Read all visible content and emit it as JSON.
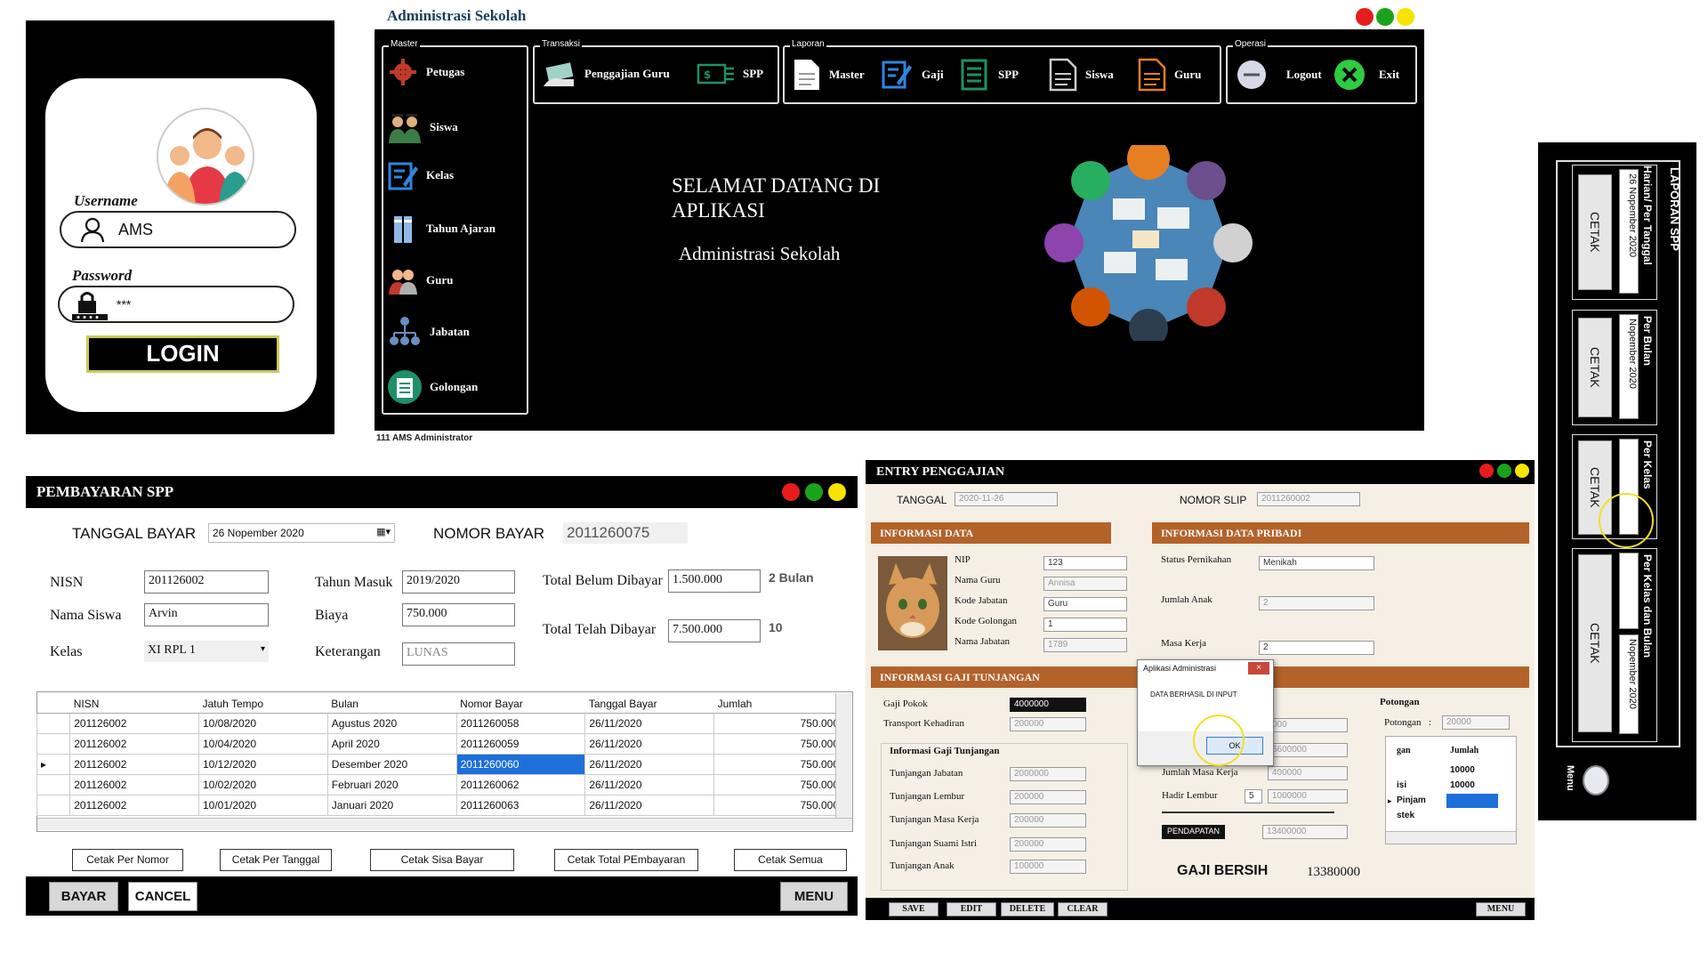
{
  "colors": {
    "dot_red": "#e81c1c",
    "dot_green": "#1aa31a",
    "dot_yellow": "#f5e300",
    "section_brown": "#b3622a",
    "selection_blue": "#1e6fd9",
    "title_navy": "#1a3d5c"
  },
  "login": {
    "username_label": "Username",
    "username_value": "AMS",
    "password_label": "Password",
    "password_value": "***",
    "login_button": "LOGIN",
    "icons": [
      "user-avatar-group-icon",
      "user-icon",
      "lock-icon"
    ]
  },
  "main": {
    "title": "Administrasi Sekolah",
    "groups": {
      "master": "Master",
      "transaksi": "Transaksi",
      "laporan": "Laporan",
      "operasi": "Operasi"
    },
    "master_items": [
      "Petugas",
      "Siswa",
      "Kelas",
      "Tahun Ajaran",
      "Guru",
      "Jabatan",
      "Golongan"
    ],
    "transaksi_items": [
      "Penggajian Guru",
      "SPP"
    ],
    "laporan_items": [
      "Master",
      "Gaji",
      "SPP",
      "Siswa",
      "Guru"
    ],
    "operasi_items": [
      "Logout",
      "Exit"
    ],
    "welcome_line1": "SELAMAT DATANG DI",
    "welcome_line2": "APLIKASI",
    "welcome_sub": "Administrasi Sekolah",
    "status_bar": "111  AMS  Administrator"
  },
  "laporan_spp": {
    "title": "LAPORAN SPP",
    "sections": [
      {
        "label": "Harian/ Per Tanggal",
        "date": "26 Nopember 2020",
        "button": "CETAK"
      },
      {
        "label": "Per Bulan",
        "date": "Nopember 2020",
        "button": "CETAK"
      },
      {
        "label": "Per Kelas",
        "date": "",
        "button": "CETAK"
      },
      {
        "label": "Per Kelas dan Bulan",
        "date": "Nopember 2020",
        "button": "CETAK"
      }
    ],
    "menu_label": "Menu"
  },
  "spp": {
    "title": "PEMBAYARAN SPP",
    "tanggal_bayar_label": "TANGGAL BAYAR",
    "tanggal_bayar_value": "26 Nopember 2020",
    "nomor_bayar_label": "NOMOR BAYAR",
    "nomor_bayar_value": "2011260075",
    "nisn_label": "NISN",
    "nisn_value": "201126002",
    "nama_label": "Nama Siswa",
    "nama_value": "Arvin",
    "kelas_label": "Kelas",
    "kelas_value": "XI RPL 1",
    "tahun_label": "Tahun Masuk",
    "tahun_value": "2019/2020",
    "biaya_label": "Biaya",
    "biaya_value": "750.000",
    "ket_label": "Keterangan",
    "ket_value": "LUNAS",
    "belum_label": "Total Belum Dibayar",
    "belum_value": "1.500.000",
    "belum_suffix": "2  Bulan",
    "telah_label": "Total Telah Dibayar",
    "telah_value": "7.500.000",
    "telah_suffix": "10",
    "columns": [
      "NISN",
      "Jatuh Tempo",
      "Bulan",
      "Nomor Bayar",
      "Tanggal Bayar",
      "Jumlah"
    ],
    "rows": [
      [
        "201126002",
        "10/08/2020",
        "Agustus 2020",
        "2011260058",
        "26/11/2020",
        "750.000"
      ],
      [
        "201126002",
        "10/04/2020",
        "April 2020",
        "2011260059",
        "26/11/2020",
        "750.000"
      ],
      [
        "201126002",
        "10/12/2020",
        "Desember 2020",
        "2011260060",
        "26/11/2020",
        "750.000"
      ],
      [
        "201126002",
        "10/02/2020",
        "Februari 2020",
        "2011260062",
        "26/11/2020",
        "750.000"
      ],
      [
        "201126002",
        "10/01/2020",
        "Januari 2020",
        "2011260063",
        "26/11/2020",
        "750.000"
      ]
    ],
    "print_buttons": [
      "Cetak Per Nomor",
      "Cetak Per Tanggal",
      "Cetak Sisa Bayar",
      "Cetak Total PEmbayaran",
      "Cetak Semua"
    ],
    "bayar_button": "BAYAR",
    "cancel_button": "CANCEL",
    "menu_button": "MENU"
  },
  "gaji": {
    "title": "ENTRY PENGGAJIAN",
    "tanggal_label": "TANGGAL",
    "tanggal_value": "2020-11-26",
    "slip_label": "NOMOR SLIP",
    "slip_value": "2011260002",
    "info_data": "INFORMASI DATA",
    "info_pribadi": "INFORMASI DATA  PRIBADI",
    "nip_label": "NIP",
    "nip_value": "123",
    "nama_guru_label": "Nama Guru",
    "nama_guru_value": "Annisa",
    "kode_jabatan_label": "Kode Jabatan",
    "kode_jabatan_value": "Guru",
    "kode_golongan_label": "Kode Golongan",
    "kode_golongan_value": "1",
    "nama_jabatan_label": "Nama Jabatan",
    "nama_jabatan_value": "1789",
    "status_label": "Status Pernikahan",
    "status_value": "Menikah",
    "anak_label": "Jumlah Anak",
    "anak_value": "2",
    "masa_label": "Masa Kerja",
    "masa_value": "2",
    "info_gaji": "INFORMASI GAJI TUNJANGAN",
    "gaji_pokok_label": "Gaji Pokok",
    "gaji_pokok_value": "4000000",
    "transport_label": "Transport Kehadiran",
    "transport_value": "200000",
    "sub_info_label": "Informasi Gaji Tunjangan",
    "tunj_jabatan_label": "Tunjangan Jabatan",
    "tunj_jabatan_value": "2000000",
    "tunj_lembur_label": "Tunjangan Lembur",
    "tunj_lembur_value": "200000",
    "tunj_masa_label": "Tunjangan Masa Kerja",
    "tunj_masa_value": "200000",
    "tunj_suami_label": "Tunjangan Suami Istri",
    "tunj_suami_value": "200000",
    "tunj_anak_label": "Tunjangan Anak",
    "tunj_anak_value": "100000",
    "mid_val1": "000",
    "mid_val2": "5600000",
    "jml_masa_label": "Jumlah Masa Kerja",
    "jml_masa_value": "400000",
    "hadir_label": "Hadir Lembur",
    "hadir_count": "5",
    "hadir_value": "1000000",
    "pendapatan_label": "PENDAPATAN",
    "pendapatan_value": "13400000",
    "potongan_title": "Potongan",
    "potongan_label": "Potongan",
    "potongan_value": "20000",
    "pot_col1": "gan",
    "pot_col2": "Jumlah",
    "pot_rows": [
      [
        "",
        "10000"
      ],
      [
        "isi",
        "10000"
      ],
      [
        "Pinjam",
        ""
      ],
      [
        "stek",
        ""
      ]
    ],
    "gaji_bersih_label": "GAJI BERSIH",
    "gaji_bersih_value": "13380000",
    "buttons": [
      "SAVE",
      "EDIT",
      "DELETE",
      "CLEAR"
    ],
    "menu_button": "MENU"
  },
  "dialog": {
    "title": "Aplikasi Administrasi",
    "close": "×",
    "message": "DATA BERHASIL DI INPUT",
    "ok": "OK"
  }
}
